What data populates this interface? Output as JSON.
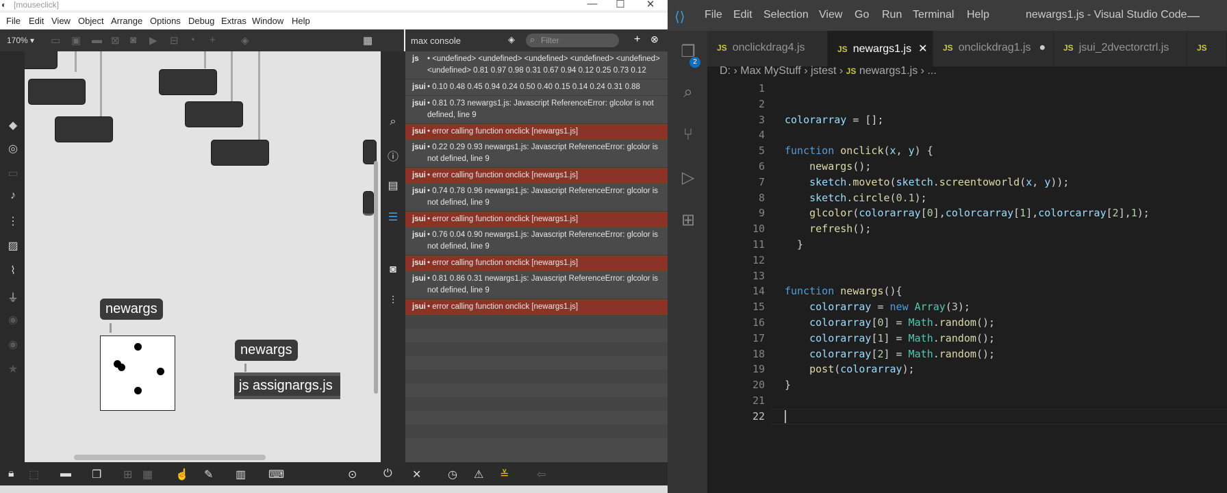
{
  "max": {
    "title": "[mouseclick]",
    "menu": [
      "File",
      "Edit",
      "View",
      "Object",
      "Arrange",
      "Options",
      "Debug",
      "Extras",
      "Window",
      "Help"
    ],
    "zoom": "170% ▾",
    "messages": [
      "newargs",
      "newargs"
    ],
    "js_object": "js assignargs.js",
    "console": {
      "title": "max console",
      "filter_placeholder": "Filter",
      "rows": [
        {
          "src": "js",
          "text": "• <undefined> <undefined> <undefined> <undefined> <undefined> <undefined> 0.81 0.97 0.98 0.31 0.67 0.94 0.12 0.25 0.73 0.12",
          "error": false
        },
        {
          "src": "jsui",
          "text": "• 0.10 0.48 0.45 0.94 0.24 0.50 0.40 0.15 0.14 0.24 0.31 0.88",
          "error": false
        },
        {
          "src": "jsui",
          "text": "• 0.81 0.73 newargs1.js: Javascript ReferenceError: glcolor is not defined, line 9",
          "error": false
        },
        {
          "src": "jsui",
          "text": "• error calling function onclick [newargs1.js]",
          "error": true
        },
        {
          "src": "jsui",
          "text": "• 0.22 0.29 0.93 newargs1.js: Javascript ReferenceError: glcolor is not defined, line 9",
          "error": false
        },
        {
          "src": "jsui",
          "text": "• error calling function onclick [newargs1.js]",
          "error": true
        },
        {
          "src": "jsui",
          "text": "• 0.74 0.78 0.96 newargs1.js: Javascript ReferenceError: glcolor is not defined, line 9",
          "error": false
        },
        {
          "src": "jsui",
          "text": "• error calling function onclick [newargs1.js]",
          "error": true
        },
        {
          "src": "jsui",
          "text": "• 0.76 0.04 0.90 newargs1.js: Javascript ReferenceError: glcolor is not defined, line 9",
          "error": false
        },
        {
          "src": "jsui",
          "text": "• error calling function onclick [newargs1.js]",
          "error": true
        },
        {
          "src": "jsui",
          "text": "• 0.81 0.86 0.31 newargs1.js: Javascript ReferenceError: glcolor is not defined, line 9",
          "error": false
        },
        {
          "src": "jsui",
          "text": "• error calling function onclick [newargs1.js]",
          "error": true
        }
      ]
    },
    "colors": {
      "error_row": "#8c3328",
      "toolbar": "#333333"
    }
  },
  "vscode": {
    "menu": [
      "File",
      "Edit",
      "Selection",
      "View",
      "Go",
      "Run",
      "Terminal",
      "Help"
    ],
    "window_title": "newargs1.js - Visual Studio Code",
    "scm_badge": "2",
    "tabs": [
      {
        "label": "onclickdrag4.js",
        "active": false,
        "modified": false
      },
      {
        "label": "newargs1.js",
        "active": true,
        "modified": false
      },
      {
        "label": "onclickdrag1.js",
        "active": false,
        "modified": true
      },
      {
        "label": "jsui_2dvectorctrl.js",
        "active": false,
        "modified": false
      }
    ],
    "breadcrumb": [
      "D:",
      "Max MyStuff",
      "jstest",
      "newargs1.js",
      "..."
    ],
    "current_line": 22,
    "code": [
      "",
      "",
      "colorarray = [];",
      "",
      "function onclick(x, y) {",
      "    newargs();",
      "    sketch.moveto(sketch.screentoworld(x, y));",
      "    sketch.circle(0.1);",
      "    glcolor(colorarray[0],colorcarray[1],colorcarray[2],1);",
      "    refresh();",
      "  }",
      "",
      "",
      "function newargs(){",
      "    colorarray = new Array(3);",
      "    colorarray[0] = Math.random();",
      "    colorarray[1] = Math.random();",
      "    colorarray[2] = Math.random();",
      "    post(colorarray);",
      "}",
      "",
      ""
    ]
  }
}
